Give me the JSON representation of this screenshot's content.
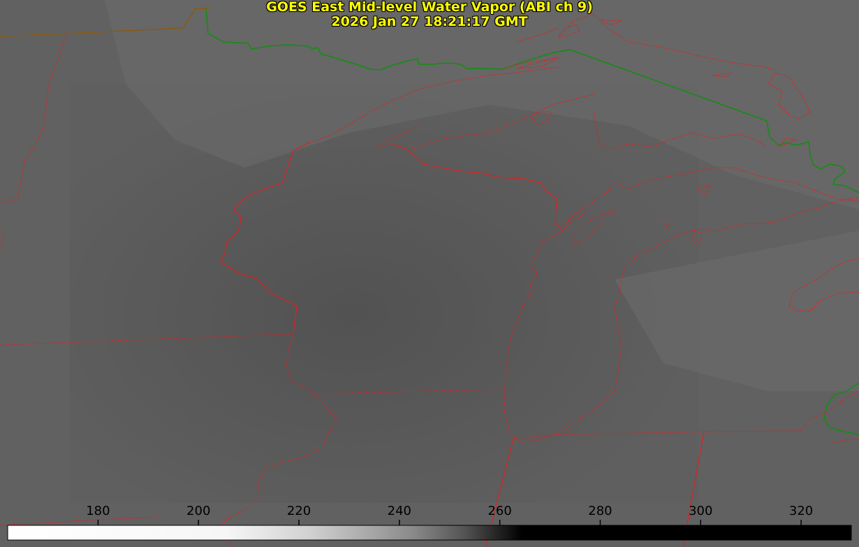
{
  "title": {
    "line1": "GOES East Mid-level Water Vapor (ABI ch 9)",
    "line2": "2026 Jan 27 18:21:17 GMT"
  },
  "colorbar": {
    "ticks": [
      "180",
      "200",
      "220",
      "240",
      "260",
      "280",
      "300",
      "320"
    ],
    "range": [
      162,
      330
    ],
    "colors": {
      "cold": "#ffffff",
      "mid": "#8a8a8a",
      "warm": "#000000"
    }
  },
  "colors": {
    "background_gray": "#5f5f5f",
    "state_border": "#e02020",
    "country_border": "#0f8f0f",
    "shared_border": "#8a5a10",
    "title_text": "#ffff00"
  }
}
